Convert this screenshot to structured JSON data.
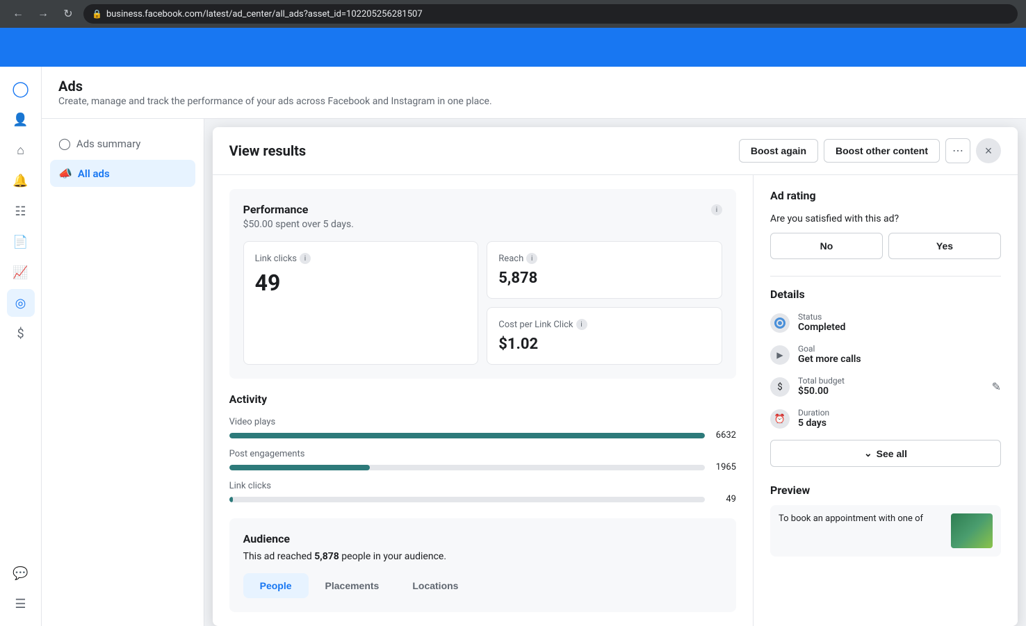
{
  "browser": {
    "url": "business.facebook.com/latest/ad_center/all_ads?asset_id=102205256281507"
  },
  "page": {
    "title": "Ads",
    "subtitle": "Create, manage and track the performance of your ads across Facebook and Instagram in one place."
  },
  "nav": {
    "ads_summary_label": "Ads summary",
    "all_ads_label": "All ads"
  },
  "panel": {
    "title": "View results",
    "boost_again_label": "Boost again",
    "boost_other_label": "Boost other content",
    "close_label": "×"
  },
  "performance": {
    "title": "Performance",
    "subtitle": "$50.00 spent over 5 days.",
    "link_clicks_label": "Link clicks",
    "link_clicks_value": "49",
    "reach_label": "Reach",
    "reach_value": "5,878",
    "cost_per_click_label": "Cost per Link Click",
    "cost_per_click_value": "$1.02"
  },
  "activity": {
    "title": "Activity",
    "bars": [
      {
        "label": "Video plays",
        "value": 6632,
        "max": 6632,
        "pct": 100
      },
      {
        "label": "Post engagements",
        "value": 1965,
        "max": 6632,
        "pct": 29.6
      },
      {
        "label": "Link clicks",
        "value": 49,
        "max": 6632,
        "pct": 0.7
      }
    ]
  },
  "audience": {
    "title": "Audience",
    "description_prefix": "This ad reached ",
    "reach_count": "5,878",
    "description_suffix": " people in your audience.",
    "tabs": [
      {
        "label": "People",
        "active": true
      },
      {
        "label": "Placements",
        "active": false
      },
      {
        "label": "Locations",
        "active": false
      }
    ]
  },
  "ad_rating": {
    "title": "Ad rating",
    "question": "Are you satisfied with this ad?",
    "no_label": "No",
    "yes_label": "Yes"
  },
  "details": {
    "title": "Details",
    "status_label": "Status",
    "status_value": "Completed",
    "goal_label": "Goal",
    "goal_value": "Get more calls",
    "budget_label": "Total budget",
    "budget_value": "$50.00",
    "duration_label": "Duration",
    "duration_value": "5 days",
    "see_all_label": "See all"
  },
  "preview": {
    "title": "Preview",
    "text": "To book an appointment with one of"
  }
}
